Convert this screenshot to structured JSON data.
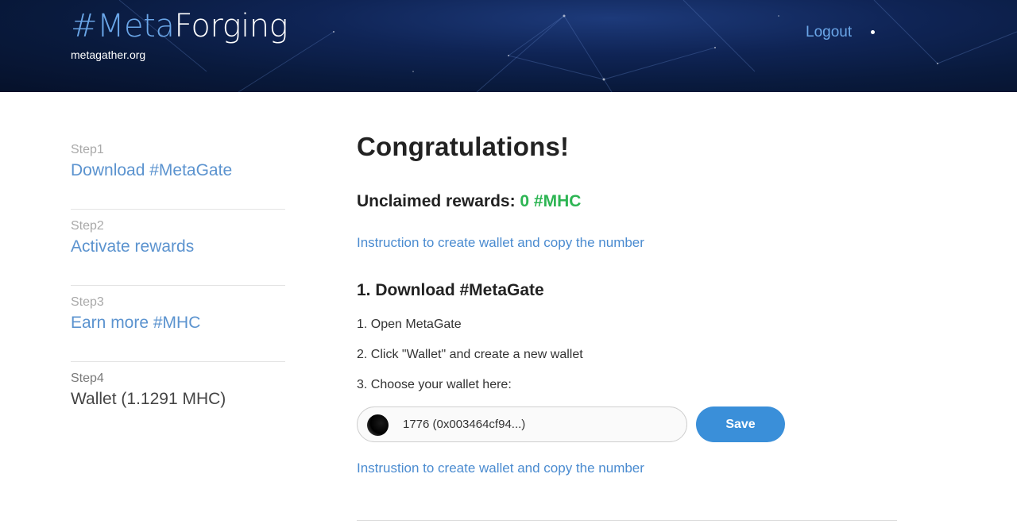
{
  "header": {
    "brand_hash": "#Meta",
    "brand_rest": "Forging",
    "site": "metagather.org",
    "logout_label": "Logout"
  },
  "sidebar": {
    "steps": [
      {
        "num": "Step1",
        "label": "Download #MetaGate"
      },
      {
        "num": "Step2",
        "label": "Activate rewards"
      },
      {
        "num": "Step3",
        "label": "Earn more #MHC"
      },
      {
        "num": "Step4",
        "label": "Wallet (1.1291 MHC)"
      }
    ]
  },
  "main": {
    "title": "Congratulations!",
    "rewards_label": "Unclaimed rewards: ",
    "rewards_amount": "0 #MHC",
    "instruction_link": "Instruction to create wallet and copy the number",
    "section_title": "1. Download #MetaGate",
    "steps": [
      "1. Open MetaGate",
      "2. Click \"Wallet\" and create a new wallet",
      "3. Choose your wallet here:"
    ],
    "wallet_selected": "1776 (0x003464cf94...)",
    "save_label": "Save",
    "instruction_link2": "Instrustion to create wallet and copy the number"
  },
  "colors": {
    "accent": "#4a8bd0",
    "reward_green": "#2db553",
    "button": "#3a8fd9"
  }
}
